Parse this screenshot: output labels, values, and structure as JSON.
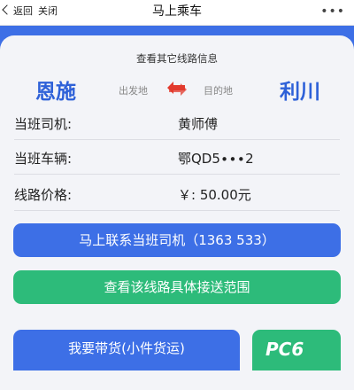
{
  "topbar": {
    "back_label": "返回",
    "close_label": "关闭",
    "title": "马上乘车",
    "more_label": "•••"
  },
  "route": {
    "other_link": "查看其它线路信息",
    "from_city": "恩施",
    "to_city": "利川",
    "from_label": "出发地",
    "to_label": "目的地"
  },
  "info": [
    {
      "key": "当班司机:",
      "value": "黄师傅"
    },
    {
      "key": "当班车辆:",
      "value": "鄂QD5∙∙∙2"
    },
    {
      "key": "线路价格:",
      "value": "￥:  50.00元"
    }
  ],
  "buttons": {
    "contact_driver": "马上联系当班司机（1363        533）",
    "view_range": "查看该线路具体接送范围",
    "carry_goods": "我要带货(小件货运)"
  },
  "colors": {
    "primary": "#3d6fe6",
    "green": "#2dbb7a"
  },
  "watermark": "PC6"
}
